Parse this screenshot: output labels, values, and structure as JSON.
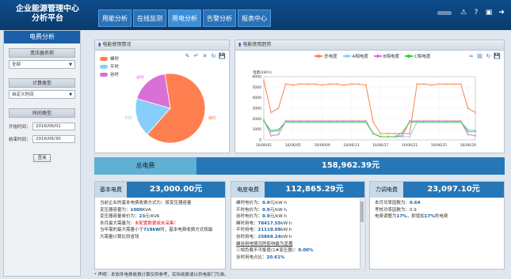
{
  "header": {
    "brand_line1": "企业能源管理中心",
    "brand_line2": "分析平台",
    "nav_tabs": [
      "用能分析",
      "在线监测",
      "用电分析",
      "告警分析",
      "报表中心"
    ],
    "active_tab": "用电分析",
    "icons": [
      "alert-icon",
      "help-icon",
      "monitor-icon",
      "logout-icon"
    ]
  },
  "sidebar": {
    "title": "电费分析",
    "transformer_label": "变压器名称",
    "transformer_value": "全部",
    "calc_type_label": "计算类型",
    "calc_type_value": "自定义时间",
    "time_label": "时间类型",
    "start_label": "开始时间：",
    "start_value": "2016/06/01",
    "end_label": "结束时间：",
    "end_value": "2016/06/30",
    "query_label": "查询"
  },
  "usage_panel": {
    "title": "电能使用情况",
    "legend": [
      {
        "label": "峰时",
        "color": "#ff7f50"
      },
      {
        "label": "平时",
        "color": "#87cefa"
      },
      {
        "label": "谷时",
        "color": "#da70d6"
      }
    ]
  },
  "trend_panel": {
    "title": "电能使用趋势",
    "legend": [
      {
        "label": "总电度",
        "color": "#ff7f50"
      },
      {
        "label": "A相电度",
        "color": "#87cefa"
      },
      {
        "label": "B相电度",
        "color": "#da70d6"
      },
      {
        "label": "C相电度",
        "color": "#32cd32"
      }
    ]
  },
  "chart_data": [
    {
      "type": "pie",
      "labels": [
        "峰时",
        "平时",
        "谷时"
      ],
      "values": [
        64,
        18,
        18
      ],
      "colors": [
        "#ff7f50",
        "#87cefa",
        "#da70d6"
      ]
    },
    {
      "type": "line",
      "ylabel": "电量(kW·h)",
      "ylim": [
        0,
        6000
      ],
      "yticks": [
        0,
        1000,
        2000,
        3000,
        4000,
        5000,
        6000
      ],
      "x": [
        "16/06/01",
        "16/06/02",
        "16/06/03",
        "16/06/04",
        "16/06/05",
        "16/06/06",
        "16/06/07",
        "16/06/08",
        "16/06/09",
        "16/06/10",
        "16/06/11",
        "16/06/12",
        "16/06/13",
        "16/06/14",
        "16/06/15",
        "16/06/16",
        "16/06/17",
        "16/06/18",
        "16/06/19",
        "16/06/20",
        "16/06/21",
        "16/06/22",
        "16/06/23",
        "16/06/24",
        "16/06/25",
        "16/06/26",
        "16/06/27",
        "16/06/28",
        "16/06/29",
        "16/06/30"
      ],
      "xtick_labels": [
        "16/06/01",
        "16/06/05",
        "16/06/09",
        "16/06/13",
        "16/06/17",
        "16/06/21",
        "16/06/25",
        "16/06/29"
      ],
      "series": [
        {
          "name": "总电度",
          "color": "#ff7f50",
          "values": [
            5600,
            2600,
            3000,
            5300,
            5200,
            5300,
            5300,
            5300,
            5200,
            5300,
            5300,
            5200,
            5300,
            5300,
            5200,
            1700,
            600,
            600,
            600,
            600,
            600,
            5300,
            5300,
            5200,
            5300,
            5300,
            5300,
            5300,
            3000,
            2600
          ]
        },
        {
          "name": "A相电度",
          "color": "#87cefa",
          "values": [
            1800,
            900,
            1000,
            1700,
            1700,
            1700,
            1700,
            1700,
            1700,
            1700,
            1700,
            1700,
            1700,
            1700,
            1700,
            600,
            300,
            300,
            300,
            300,
            300,
            1700,
            1700,
            1700,
            1700,
            1700,
            1700,
            1700,
            1000,
            900
          ]
        },
        {
          "name": "B相电度",
          "color": "#da70d6",
          "values": [
            1900,
            400,
            500,
            1800,
            1800,
            1800,
            1800,
            1800,
            1800,
            1800,
            1800,
            1800,
            1800,
            1800,
            1800,
            600,
            300,
            300,
            300,
            400,
            1800,
            1800,
            1800,
            1800,
            1800,
            1800,
            1800,
            1800,
            500,
            400
          ]
        },
        {
          "name": "C相电度",
          "color": "#32cd32",
          "values": [
            1800,
            800,
            900,
            1700,
            1700,
            1700,
            1700,
            1700,
            1700,
            1700,
            1700,
            1700,
            1700,
            1700,
            1700,
            600,
            300,
            300,
            300,
            700,
            1700,
            1700,
            1700,
            1700,
            1700,
            1700,
            1700,
            1700,
            800,
            800
          ]
        }
      ]
    }
  ],
  "summary": {
    "total_label": "总电费",
    "total_value": "158,962.39元"
  },
  "basic_fee": {
    "label": "基本电费",
    "value": "23,000.00元",
    "lines": [
      {
        "text": "当前企业的基本电费收费方式为：按变压器容量"
      },
      {
        "pre": "变压器容量为：",
        "val": "1000",
        "post": "KVA"
      },
      {
        "pre": "变压器容量单价为：",
        "val": "23",
        "post": "元/KVA"
      },
      {
        "pre": "本月最大需量为：",
        "red": "未配置数据或未采集！"
      },
      {
        "pre": "当年需的最大需量小于",
        "val": "719kW",
        "post": "时，基本电费收费方式按最"
      },
      {
        "text": "大需量计算比较省钱"
      }
    ]
  },
  "power_fee": {
    "label": "电度电费",
    "value": "112,865.29元",
    "lines": [
      {
        "pre": "峰时电价为：",
        "val": "0.9",
        "post": "元/kW·h"
      },
      {
        "pre": "平时电价为：",
        "val": "0.9",
        "post": "元/kW·h"
      },
      {
        "pre": "谷时电价为：",
        "val": "0.9",
        "post": "元/kW·h"
      },
      {
        "pre": "峰时用电：",
        "val": "78417.55",
        "post": "kW·h"
      },
      {
        "pre": "平时用电：",
        "val": "21119.09",
        "post": "kW·h"
      },
      {
        "pre": "谷时用电：",
        "val": "25869.24",
        "post": "kW·h"
      },
      {
        "underline": "峰谷用电情况的影响最为显著"
      },
      {
        "pre": "三相负载不平衡度(1#变压器)：",
        "val": "0.00%"
      },
      {
        "pre": "谷时用电占比：",
        "val": "20.61%"
      }
    ]
  },
  "force_fee": {
    "label": "力调电费",
    "value": "23,097.10元",
    "lines": [
      {
        "pre": "本月功率因数为：",
        "val": "0.64"
      },
      {
        "pre": "考核功率因数为：",
        "val": "0.9"
      },
      {
        "pre": "电费调整为",
        "val": "17%",
        "mid": "，即增加",
        "val2": "17%",
        "post": "的电费"
      }
    ]
  },
  "disclaimer": "* 声明：本软件电费收费计算仅供参考，实际收费请以供电部门为准。"
}
